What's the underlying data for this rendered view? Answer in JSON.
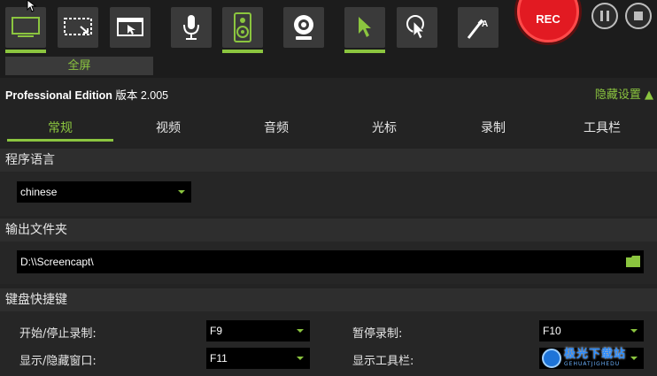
{
  "toolbar": {
    "mode_label": "全屏",
    "rec_label": "REC",
    "buttons": [
      "fullscreen-icon",
      "region-icon",
      "window-icon",
      "microphone-icon",
      "speaker-icon",
      "webcam-icon",
      "cursor-icon",
      "click-highlight-icon",
      "annotate-icon"
    ],
    "active_color": "#8bc53f",
    "rec_color": "#e21a22"
  },
  "edition": {
    "name": "Professional Edition",
    "version_label": "版本",
    "version": "2.005"
  },
  "hide_settings": "隐藏设置 ▲",
  "tabs": [
    "常规",
    "视频",
    "音频",
    "光标",
    "录制",
    "工具栏"
  ],
  "active_tab": "常规",
  "language": {
    "title": "程序语言",
    "value": "chinese"
  },
  "output": {
    "title": "输出文件夹",
    "path": "D:\\\\Screencapt\\"
  },
  "hotkeys": {
    "title": "键盘快捷键",
    "start_stop_label": "开始/停止录制:",
    "start_stop_key": "F9",
    "pause_label": "暂停录制:",
    "pause_key": "F10",
    "show_hide_label": "显示/隐藏窗口:",
    "show_hide_key": "F11",
    "show_toolbar_label": "显示工具栏:"
  },
  "watermark": {
    "main": "极光下载站",
    "sub": "GEHUATJIGHEDU"
  }
}
